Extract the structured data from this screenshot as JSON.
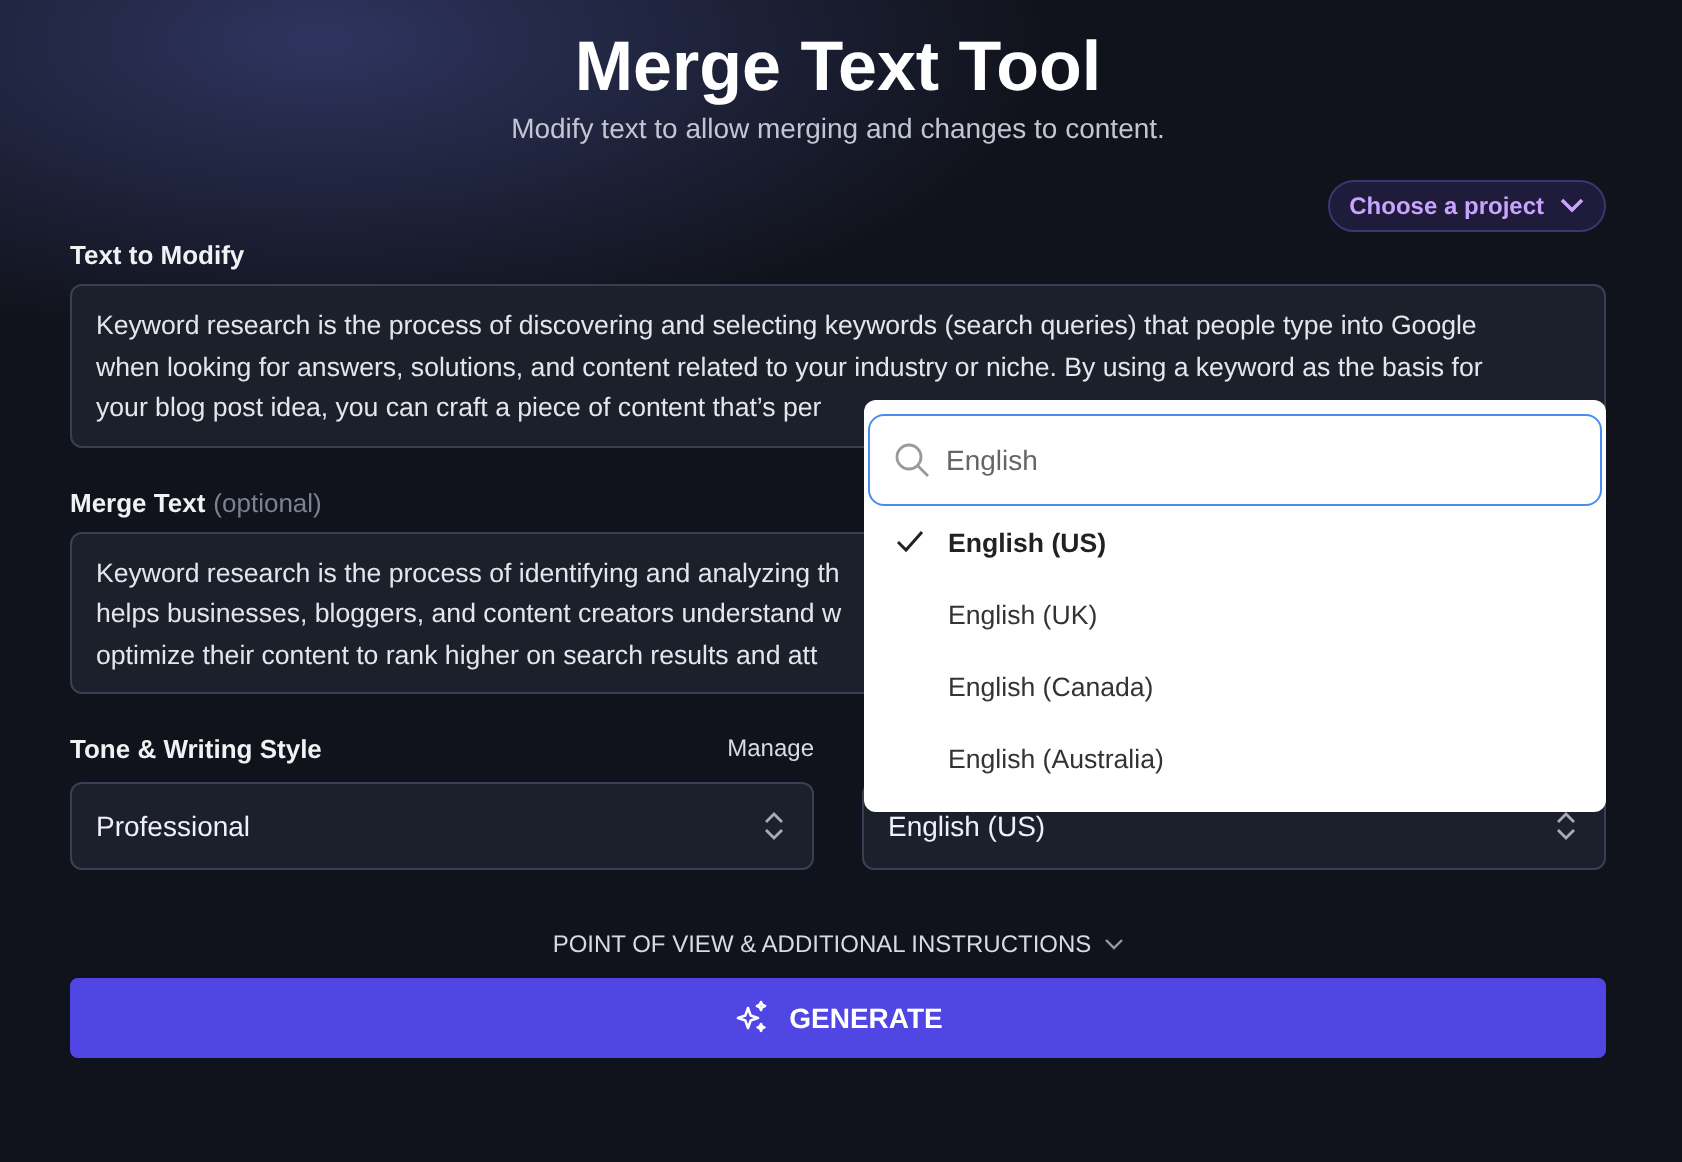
{
  "header": {
    "title": "Merge Text Tool",
    "subtitle": "Modify text to allow merging and changes to content."
  },
  "project_button": {
    "label": "Choose a project"
  },
  "text_to_modify": {
    "label": "Text to Modify",
    "lines": [
      "Keyword research is the process of discovering and selecting keywords (search queries) that people type into Google",
      "when looking for answers, solutions, and content related to your industry or niche. By using a keyword as the basis for",
      "your blog post idea, you can craft a piece of content that’s per"
    ]
  },
  "merge_text": {
    "label": "Merge Text",
    "hint": "(optional)",
    "lines": [
      "Keyword research is the process of identifying and analyzing th",
      "helps businesses, bloggers, and content creators understand w",
      "optimize their content to rank higher on search results and att"
    ]
  },
  "tone": {
    "label": "Tone & Writing Style",
    "manage": "Manage",
    "value": "Professional"
  },
  "language": {
    "value": "English (US)",
    "dropdown": {
      "search": "English",
      "options": [
        {
          "label": "English (US)",
          "selected": true
        },
        {
          "label": "English (UK)",
          "selected": false
        },
        {
          "label": "English (Canada)",
          "selected": false
        },
        {
          "label": "English (Australia)",
          "selected": false
        }
      ]
    }
  },
  "more_toggle": {
    "label": "POINT OF VIEW & ADDITIONAL INSTRUCTIONS"
  },
  "generate_button": {
    "label": "GENERATE"
  }
}
